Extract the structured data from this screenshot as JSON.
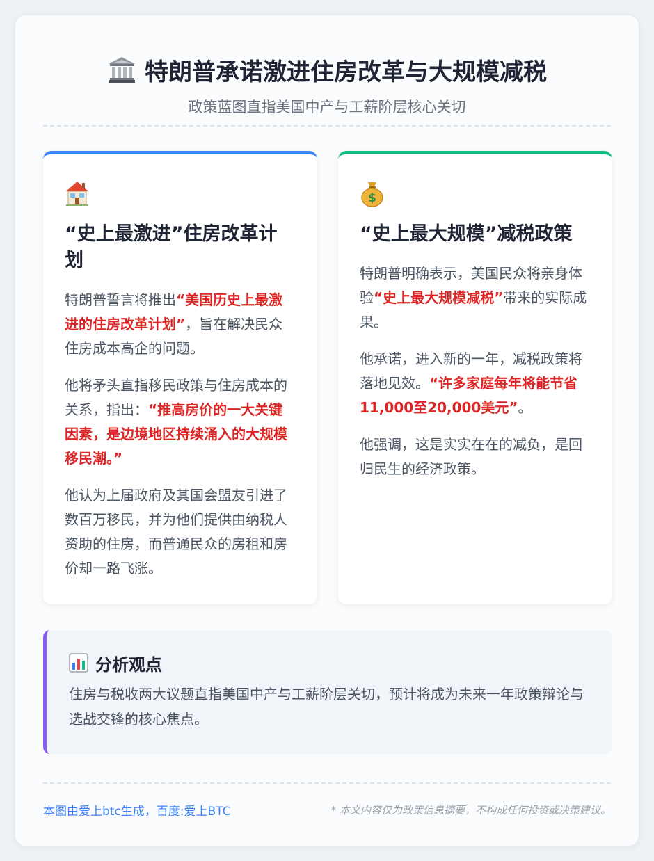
{
  "header": {
    "title": "特朗普承诺激进住房改革与大规模减税",
    "subtitle": "政策蓝图直指美国中产与工薪阶层核心关切",
    "icon": "bank-building-icon"
  },
  "cards": [
    {
      "icon": "house-icon",
      "accent": "#3b82f6",
      "title": "“史上最激进”住房改革计划",
      "paragraphs": [
        {
          "pre": "特朗普誓言将推出",
          "highlight": "“美国历史上最激进的住房改革计划”",
          "post": "，旨在解决民众住房成本高企的问题。"
        },
        {
          "pre": "他将矛头直指移民政策与住房成本的关系，指出：",
          "highlight": "“推高房价的一大关键因素，是边境地区持续涌入的大规模移民潮。”",
          "post": ""
        },
        {
          "pre": "他认为上届政府及其国会盟友引进了数百万移民，并为他们提供由纳税人资助的住房，而普通民众的房租和房价却一路飞涨。",
          "highlight": "",
          "post": ""
        }
      ]
    },
    {
      "icon": "money-bag-icon",
      "accent": "#10b981",
      "title": "“史上最大规模”减税政策",
      "paragraphs": [
        {
          "pre": "特朗普明确表示，美国民众将亲身体验",
          "highlight": "“史上最大规模减税”",
          "post": "带来的实际成果。"
        },
        {
          "pre": "他承诺，进入新的一年，减税政策将落地见效。",
          "highlight": "“许多家庭每年将能节省11,000至20,000美元”",
          "post": "。"
        },
        {
          "pre": "他强调，这是实实在在的减负，是回归民生的经济政策。",
          "highlight": "",
          "post": ""
        }
      ]
    }
  ],
  "analysis": {
    "icon": "bar-chart-icon",
    "title": "分析观点",
    "text": "住房与税收两大议题直指美国中产与工薪阶层关切，预计将成为未来一年政策辩论与选战交锋的核心焦点。",
    "accent": "#8b5cf6"
  },
  "footer": {
    "credit": "本图由爱上btc生成，百度:爱上BTC",
    "disclaimer": "* 本文内容仅为政策信息摘要，不构成任何投资或决策建议。"
  },
  "colors": {
    "highlight": "#dc2626"
  }
}
